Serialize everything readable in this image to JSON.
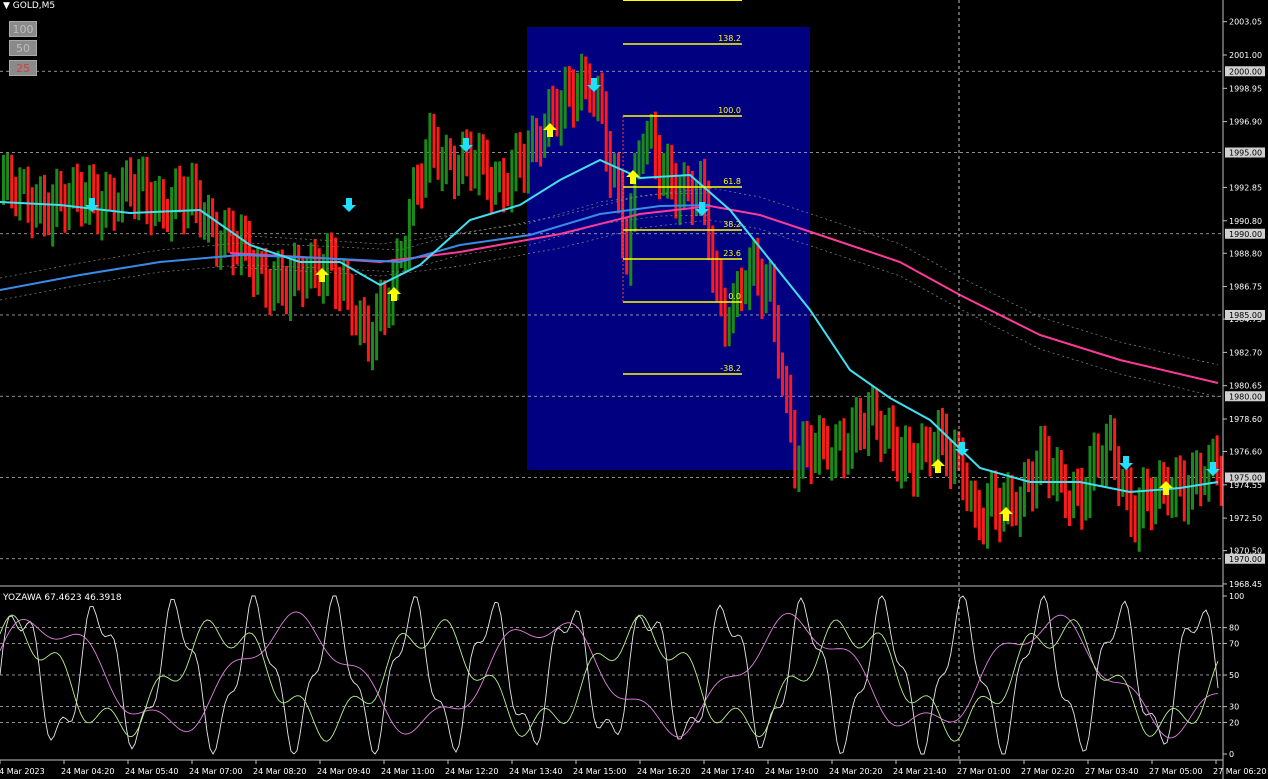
{
  "header": {
    "symbol": "GOLD,M5",
    "collapse_icon": "triangle-down-icon"
  },
  "timeframe_buttons": [
    "100",
    "50",
    "25"
  ],
  "price_axis": {
    "ticks": [
      "2003.05",
      "2001.00",
      "1998.95",
      "1996.90",
      "1992.85",
      "1990.80",
      "1988.80",
      "1986.75",
      "1984.75",
      "1982.70",
      "1980.65",
      "1978.60",
      "1976.60",
      "1974.55",
      "1972.50",
      "1970.50",
      "1968.45"
    ],
    "levels": [
      "2000.00",
      "1995.00",
      "1990.00",
      "1985.00",
      "1980.00",
      "1975.00",
      "1970.00"
    ]
  },
  "fibonacci": {
    "levels": [
      "138.2",
      "100.0",
      "61.8",
      "38.2",
      "23.6",
      "0.0",
      "-38.2"
    ],
    "color": "#ffff00",
    "zone_color": "#000080"
  },
  "indicator": {
    "title": "YOZAWA 67.4623 46.3918",
    "axis_ticks": [
      "100",
      "80",
      "70",
      "50",
      "30",
      "20",
      "0"
    ]
  },
  "time_axis": [
    "24 Mar 2023",
    "24 Mar 04:20",
    "24 Mar 05:40",
    "24 Mar 07:00",
    "24 Mar 08:20",
    "24 Mar 09:40",
    "24 Mar 11:00",
    "24 Mar 12:20",
    "24 Mar 13:40",
    "24 Mar 15:00",
    "24 Mar 16:20",
    "24 Mar 17:40",
    "24 Mar 19:00",
    "24 Mar 20:20",
    "24 Mar 21:40",
    "27 Mar 01:00",
    "27 Mar 02:20",
    "27 Mar 03:40",
    "27 Mar 05:00",
    "27 Mar 06:20"
  ],
  "colors": {
    "up": "#1a8a1a",
    "down": "#ff1a1a",
    "ma_fast": "#40e0f0",
    "ma_mid": "#3a8ae8",
    "ma_slow": "#ff3a9a",
    "arrow_up": "#ffff00",
    "arrow_down": "#20e0ff"
  }
}
